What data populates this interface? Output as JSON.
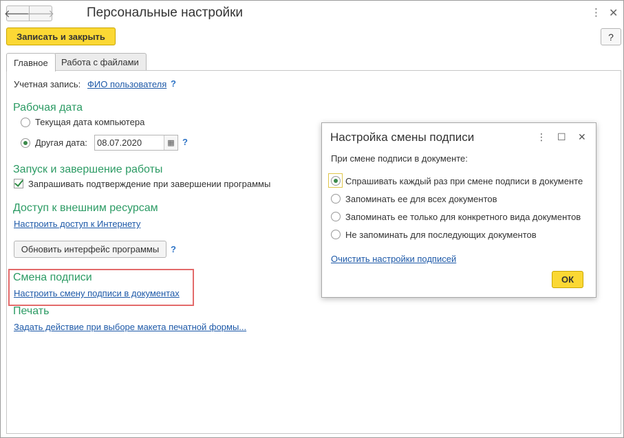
{
  "window": {
    "title": "Персональные настройки",
    "back_icon": "🡐",
    "forward_icon": "🡒",
    "more_icon": "⋮",
    "close_icon": "✕"
  },
  "toolbar": {
    "save_close_label": "Записать и закрыть",
    "help_label": "?"
  },
  "tabs": [
    {
      "label": "Главное",
      "active": true
    },
    {
      "label": "Работа с файлами",
      "active": false
    }
  ],
  "main": {
    "account": {
      "label": "Учетная запись:",
      "value": "ФИО пользователя",
      "help": "?"
    },
    "work_date": {
      "heading": "Рабочая дата",
      "option_computer": "Текущая дата компьютера",
      "option_other": "Другая дата:",
      "date_value": "08.07.2020",
      "help": "?"
    },
    "startup": {
      "heading": "Запуск и завершение работы",
      "confirm_exit_label": "Запрашивать подтверждение при завершении программы",
      "confirm_exit_checked": true
    },
    "external": {
      "heading": "Доступ к внешним ресурсам",
      "internet_link": "Настроить доступ к Интернету"
    },
    "update_button_label": "Обновить интерфейс программы",
    "update_help": "?",
    "signature": {
      "heading": "Смена подписи",
      "link": "Настроить смену подписи в документах"
    },
    "print": {
      "heading": "Печать",
      "link": "Задать действие при выборе макета печатной формы..."
    }
  },
  "dialog": {
    "title": "Настройка смены подписи",
    "more_icon": "⋮",
    "maximize_icon": "☐",
    "close_icon": "✕",
    "prompt": "При смене подписи в документе:",
    "options": [
      "Спрашивать каждый раз при смене подписи в документе",
      "Запоминать ее для всех документов",
      "Запоминать ее только для конкретного вида документов",
      "Не запоминать для последующих документов"
    ],
    "selected_option": 0,
    "clear_link": "Очистить настройки подписей",
    "ok_label": "ОК"
  },
  "colors": {
    "accent_yellow": "#fbd834",
    "section_green": "#2c9b64",
    "link_blue": "#1d59a8",
    "highlight_red": "#e36a6a"
  }
}
